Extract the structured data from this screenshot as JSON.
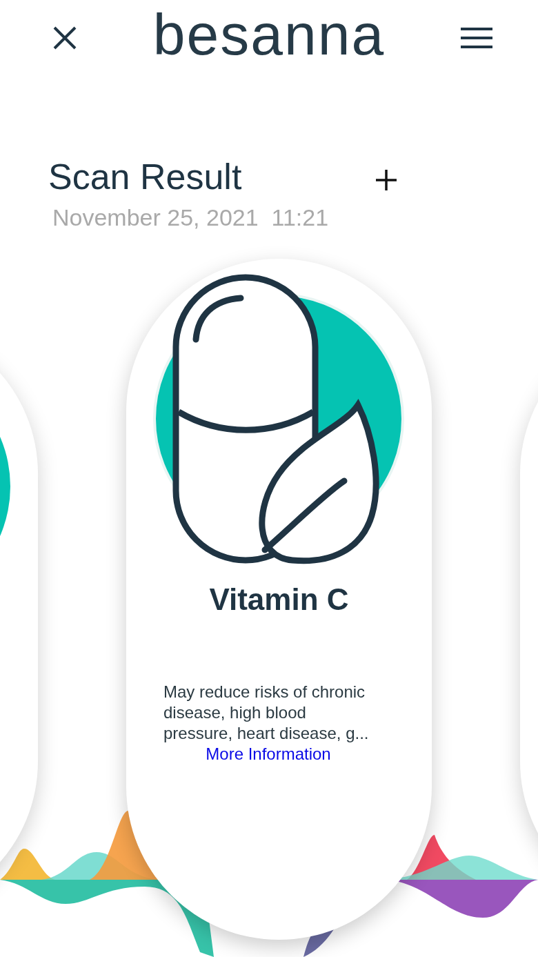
{
  "header": {
    "logo": "besanna"
  },
  "scan": {
    "title": "Scan Result",
    "date": "November 25, 2021  11:21"
  },
  "cards": [
    {
      "kind": "side"
    },
    {
      "kind": "main",
      "name": "Vitamin C",
      "description": "May reduce risks of chronic disease, high blood pressure, heart disease, g...",
      "link": "More Information"
    },
    {
      "kind": "side"
    }
  ]
}
